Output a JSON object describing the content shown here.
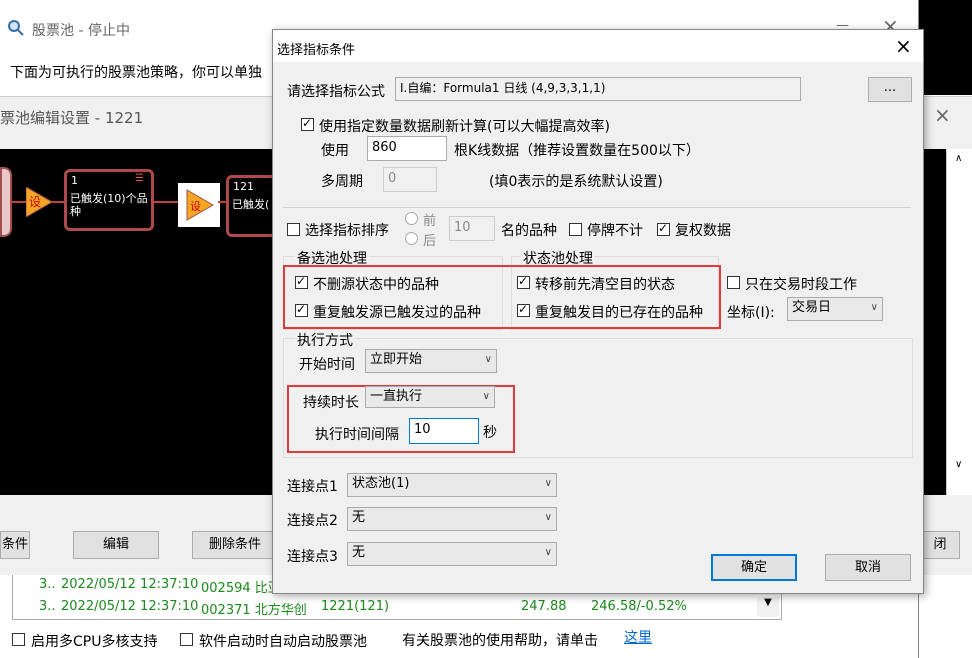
{
  "bg_window": {
    "title": "股票池 - 停止中",
    "desc": "下面为可执行的股票池策略，你可以单独",
    "close": "×",
    "min": "—",
    "status_rows": [
      {
        "c1": "3..",
        "time": "2022/05/12 12:37:10",
        "code": "002594 比亚",
        "strategy": "",
        "v1": "",
        "v2": ""
      },
      {
        "c1": "3..",
        "time": "2022/05/12 12:37:10",
        "code": "002371 北方华创",
        "strategy": "1221(121)",
        "v1": "247.88",
        "v2": "246.58/-0.52%"
      }
    ],
    "multi_cpu": "启用多CPU多核支持",
    "auto_start": "软件启动时自动启动股票池",
    "help_text": "有关股票池的使用帮助，请单击",
    "help_link": "这里"
  },
  "mid_window": {
    "title": "票池编辑设置 - 1221",
    "node1_num": "1",
    "node1_text": "已触发(10)个品种",
    "node2_num": "121",
    "node2_text": "已触发(",
    "set_icon": "设",
    "btn_condition": "条件",
    "btn_edit": "编辑",
    "btn_delete": "删除条件",
    "btn_close_partial": "闭"
  },
  "dialog": {
    "title": "选择指标条件",
    "close": "×",
    "formula_label": "请选择指标公式",
    "formula_value": "I.自编：Formula1 日线 (4,9,3,3,1,1)",
    "more_btn": "...",
    "use_count_label": "使用指定数量数据刷新计算(可以大幅提高效率)",
    "use_label": "使用",
    "use_value": "860",
    "k_label": "根K线数据（推荐设置数量在500以下）",
    "multi_period_label": "多周期",
    "multi_period_value": "0",
    "multi_period_hint": "(填0表示的是系统默认设置)",
    "sort_label": "选择指标排序",
    "front": "前",
    "back": "后",
    "rank_value": "10",
    "rank_suffix": "名的品种",
    "suspend": "停牌不计",
    "restore": "复权数据",
    "pool_group": "备选池处理",
    "pool_opt1": "不删源状态中的品种",
    "pool_opt2": "重复触发源已触发过的品种",
    "state_group": "状态池处理",
    "state_opt1": "转移前先清空目的状态",
    "state_opt2": "重复触发目的已存在的品种",
    "trade_only": "只在交易时段工作",
    "axis_label": "坐标(I):",
    "axis_value": "交易日",
    "exec_group": "执行方式",
    "start_label": "开始时间",
    "start_value": "立即开始",
    "duration_label": "持续时长",
    "duration_value": "一直执行",
    "interval_label": "执行时间间隔",
    "interval_value": "10",
    "interval_unit": "秒",
    "conn1_label": "连接点1",
    "conn1_value": "状态池(1)",
    "conn2_label": "连接点2",
    "conn2_value": "无",
    "conn3_label": "连接点3",
    "conn3_value": "无",
    "ok": "确定",
    "cancel": "取消"
  }
}
